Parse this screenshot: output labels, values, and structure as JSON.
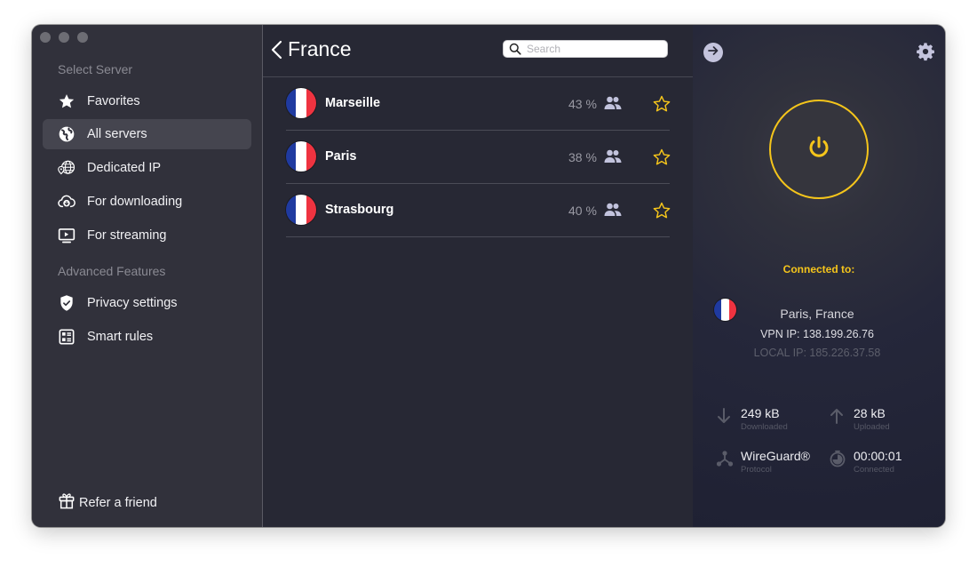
{
  "window": {
    "controls": [
      "close",
      "minimize",
      "maximize"
    ]
  },
  "sidebar": {
    "section_select_server": "Select Server",
    "items": [
      {
        "label": "Favorites",
        "icon": "star-icon",
        "active": false
      },
      {
        "label": "All servers",
        "icon": "globe-icon",
        "active": true
      },
      {
        "label": "Dedicated IP",
        "icon": "globe-pin-icon",
        "active": false
      },
      {
        "label": "For downloading",
        "icon": "cloud-download-icon",
        "active": false
      },
      {
        "label": "For streaming",
        "icon": "tv-play-icon",
        "active": false
      }
    ],
    "section_advanced": "Advanced Features",
    "advanced_items": [
      {
        "label": "Privacy settings",
        "icon": "shield-check-icon"
      },
      {
        "label": "Smart rules",
        "icon": "rules-icon"
      }
    ],
    "refer_label": "Refer a friend"
  },
  "server_list": {
    "title": "France",
    "search_placeholder": "Search",
    "search_value": "",
    "servers": [
      {
        "city": "Marseille",
        "load": "43 %",
        "favorite": false
      },
      {
        "city": "Paris",
        "load": "38 %",
        "favorite": false
      },
      {
        "city": "Strasbourg",
        "load": "40 %",
        "favorite": false
      }
    ]
  },
  "connection": {
    "status_label": "Connected to:",
    "location": "Paris, France",
    "vpn_ip": "VPN IP: 138.199.26.76",
    "local_ip": "LOCAL IP: 185.226.37.58",
    "accent_color": "#f5c51b",
    "stats": {
      "downloaded": {
        "value": "249 kB",
        "label": "Downloaded"
      },
      "uploaded": {
        "value": "28 kB",
        "label": "Uploaded"
      },
      "protocol": {
        "value": "WireGuard®",
        "label": "Protocol"
      },
      "time": {
        "value": "00:00:01",
        "label": "Connected"
      }
    }
  },
  "flag_colors": {
    "blue": "#1f3aa0",
    "white": "#ffffff",
    "red": "#ef3340"
  }
}
